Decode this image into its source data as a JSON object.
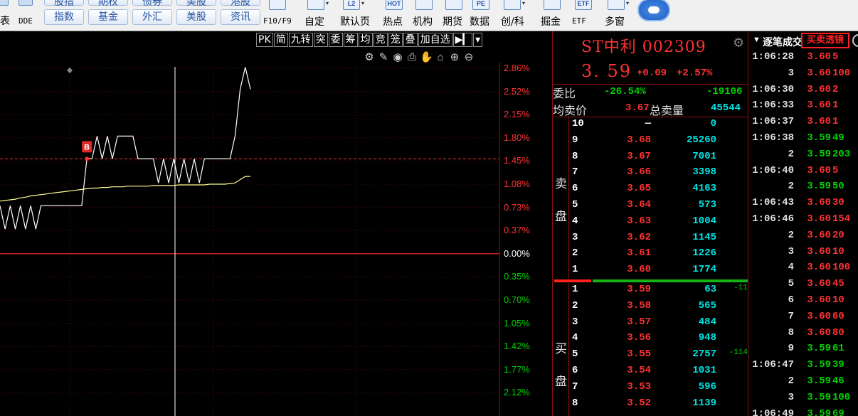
{
  "toolbar": {
    "left_labels": [
      "表",
      "DDE"
    ],
    "buttons_top": [
      "股指",
      "期权",
      "债券",
      "美股",
      "港股"
    ],
    "buttons_bottom": [
      "指数",
      "基金",
      "外汇",
      "美股",
      "资讯"
    ],
    "right_items": [
      {
        "label": "F10/F9",
        "icon": "F10-icon"
      },
      {
        "label": "自定",
        "icon": "customize-icon"
      },
      {
        "label": "默认页",
        "icon": "L2-icon",
        "icon_text": "L2"
      },
      {
        "label": "热点",
        "icon": "hot-icon",
        "icon_text": "HOT"
      },
      {
        "label": "机构",
        "icon": "institution-icon"
      },
      {
        "label": "期货",
        "icon": "futures-icon"
      },
      {
        "label": "数据",
        "icon": "data-icon",
        "icon_text": "PE"
      },
      {
        "label": "创/科",
        "icon": "star-market-icon"
      },
      {
        "label": "掘金",
        "icon": "dig-gold-icon"
      },
      {
        "label": "ETF",
        "icon": "etf-icon",
        "icon_text": "ETF"
      },
      {
        "label": "多窗",
        "icon": "multi-window-icon"
      }
    ]
  },
  "chart_toolbar": [
    "PK",
    "简",
    "九转",
    "突",
    "委",
    "筹",
    "均",
    "竞",
    "笼",
    "叠",
    "加自选"
  ],
  "chart_icons": [
    "settings-icon",
    "draw-icon",
    "eye-icon",
    "print-icon",
    "hand-icon",
    "lock-icon",
    "zoom-in-icon",
    "zoom-out-icon"
  ],
  "chart_data": {
    "type": "line",
    "title": "",
    "y_axis_percent_labels": [
      "2.86%",
      "2.52%",
      "2.15%",
      "1.80%",
      "1.45%",
      "1.08%",
      "0.73%",
      "0.37%",
      "0.00%",
      "0.35%",
      "0.70%",
      "1.05%",
      "1.42%",
      "1.77%",
      "2.12%"
    ],
    "y_axis_signs": [
      "up",
      "up",
      "up",
      "up",
      "up",
      "up",
      "up",
      "up",
      "zero",
      "down",
      "down",
      "down",
      "down",
      "down",
      "down"
    ],
    "ylim_percent": [
      -2.47,
      2.86
    ],
    "series": [
      {
        "color": "#ffffff",
        "style": "price",
        "values_percent": [
          0.73,
          0.37,
          0.73,
          0.37,
          0.73,
          0.37,
          0.73,
          0.37,
          0.73,
          0.73,
          0.73,
          0.73,
          0.73,
          0.73,
          0.73,
          0.73,
          0.73,
          1.45,
          1.45,
          1.8,
          1.45,
          1.8,
          1.45,
          1.8,
          1.8,
          1.8,
          1.8,
          1.45,
          1.45,
          1.45,
          1.45,
          1.08,
          1.45,
          1.08,
          1.45,
          1.08,
          1.45,
          1.08,
          1.45,
          1.08,
          1.45,
          1.45,
          1.45,
          1.45,
          1.45,
          1.45,
          1.8,
          2.52,
          2.86,
          2.52
        ]
      },
      {
        "color": "#ffff96",
        "style": "average",
        "values_percent": [
          0.8,
          0.81,
          0.82,
          0.83,
          0.85,
          0.86,
          0.88,
          0.89,
          0.9,
          0.91,
          0.92,
          0.93,
          0.94,
          0.95,
          0.96,
          0.97,
          0.98,
          0.99,
          1.0,
          1.0,
          1.01,
          1.01,
          1.02,
          1.02,
          1.02,
          1.03,
          1.03,
          1.03,
          1.03,
          1.03,
          1.04,
          1.04,
          1.04,
          1.04,
          1.04,
          1.05,
          1.05,
          1.05,
          1.05,
          1.05,
          1.05,
          1.06,
          1.06,
          1.06,
          1.06,
          1.07,
          1.08,
          1.13,
          1.18,
          1.18
        ]
      }
    ],
    "reference_percent": 1.45,
    "buy_marker": {
      "label": "B",
      "index": 17
    }
  },
  "quote": {
    "title": "ST中利 002309",
    "price": "3. 59",
    "change": "+0.09",
    "change_pct": "+2.57%",
    "weibi_label": "委比",
    "weibi_pct": "-26.54%",
    "weibi_diff": "-19106",
    "avg_label": "均卖价",
    "avg_value": "3.67",
    "total_sell_label": "总卖量",
    "total_sell_value": "45544",
    "sell_side_label": [
      "卖",
      "盘"
    ],
    "buy_side_label": [
      "买",
      "盘"
    ],
    "sell": [
      {
        "level": "10",
        "price": "—",
        "vol": "0"
      },
      {
        "level": "9",
        "price": "3.68",
        "vol": "25260"
      },
      {
        "level": "8",
        "price": "3.67",
        "vol": "7001"
      },
      {
        "level": "7",
        "price": "3.66",
        "vol": "3398"
      },
      {
        "level": "6",
        "price": "3.65",
        "vol": "4163"
      },
      {
        "level": "5",
        "price": "3.64",
        "vol": "573"
      },
      {
        "level": "4",
        "price": "3.63",
        "vol": "1004"
      },
      {
        "level": "3",
        "price": "3.62",
        "vol": "1145"
      },
      {
        "level": "2",
        "price": "3.61",
        "vol": "1226"
      },
      {
        "level": "1",
        "price": "3.60",
        "vol": "1774"
      }
    ],
    "buy": [
      {
        "level": "1",
        "price": "3.59",
        "vol": "63",
        "delta": "-11"
      },
      {
        "level": "2",
        "price": "3.58",
        "vol": "565",
        "delta": ""
      },
      {
        "level": "3",
        "price": "3.57",
        "vol": "484",
        "delta": ""
      },
      {
        "level": "4",
        "price": "3.56",
        "vol": "948",
        "delta": ""
      },
      {
        "level": "5",
        "price": "3.55",
        "vol": "2757",
        "delta": "-114"
      },
      {
        "level": "6",
        "price": "3.54",
        "vol": "1031",
        "delta": ""
      },
      {
        "level": "7",
        "price": "3.53",
        "vol": "596",
        "delta": ""
      },
      {
        "level": "8",
        "price": "3.52",
        "vol": "1139",
        "delta": ""
      }
    ]
  },
  "trades": {
    "title": "逐笔成交",
    "tab": "买卖透镜",
    "rows": [
      {
        "time": "1:06:28",
        "price": "3.60",
        "vol": "5",
        "side": "buy"
      },
      {
        "time": "3",
        "price": "3.60",
        "vol": "100",
        "side": "buy"
      },
      {
        "time": "1:06:30",
        "price": "3.60",
        "vol": "2",
        "side": "buy"
      },
      {
        "time": "1:06:33",
        "price": "3.60",
        "vol": "1",
        "side": "buy"
      },
      {
        "time": "1:06:37",
        "price": "3.60",
        "vol": "1",
        "side": "buy"
      },
      {
        "time": "1:06:38",
        "price": "3.59",
        "vol": "49",
        "side": "sell"
      },
      {
        "time": "2",
        "price": "3.59",
        "vol": "203",
        "side": "sell"
      },
      {
        "time": "1:06:40",
        "price": "3.60",
        "vol": "5",
        "side": "buy"
      },
      {
        "time": "2",
        "price": "3.59",
        "vol": "50",
        "side": "sell"
      },
      {
        "time": "1:06:43",
        "price": "3.60",
        "vol": "30",
        "side": "buy"
      },
      {
        "time": "1:06:46",
        "price": "3.60",
        "vol": "154",
        "side": "buy"
      },
      {
        "time": "2",
        "price": "3.60",
        "vol": "20",
        "side": "buy"
      },
      {
        "time": "3",
        "price": "3.60",
        "vol": "10",
        "side": "buy"
      },
      {
        "time": "4",
        "price": "3.60",
        "vol": "100",
        "side": "buy"
      },
      {
        "time": "5",
        "price": "3.60",
        "vol": "45",
        "side": "buy"
      },
      {
        "time": "6",
        "price": "3.60",
        "vol": "10",
        "side": "buy"
      },
      {
        "time": "7",
        "price": "3.60",
        "vol": "60",
        "side": "buy"
      },
      {
        "time": "8",
        "price": "3.60",
        "vol": "80",
        "side": "buy"
      },
      {
        "time": "9",
        "price": "3.59",
        "vol": "61",
        "side": "sell"
      },
      {
        "time": "1:06:47",
        "price": "3.59",
        "vol": "39",
        "side": "sell"
      },
      {
        "time": "2",
        "price": "3.59",
        "vol": "46",
        "side": "sell"
      },
      {
        "time": "3",
        "price": "3.59",
        "vol": "100",
        "side": "sell"
      },
      {
        "time": "1:06:49",
        "price": "3.59",
        "vol": "69",
        "side": "sell"
      }
    ]
  },
  "colors": {
    "up": "#ff3232",
    "down": "#00d200",
    "volume": "#00e5e5",
    "grid": "#8a1010"
  }
}
